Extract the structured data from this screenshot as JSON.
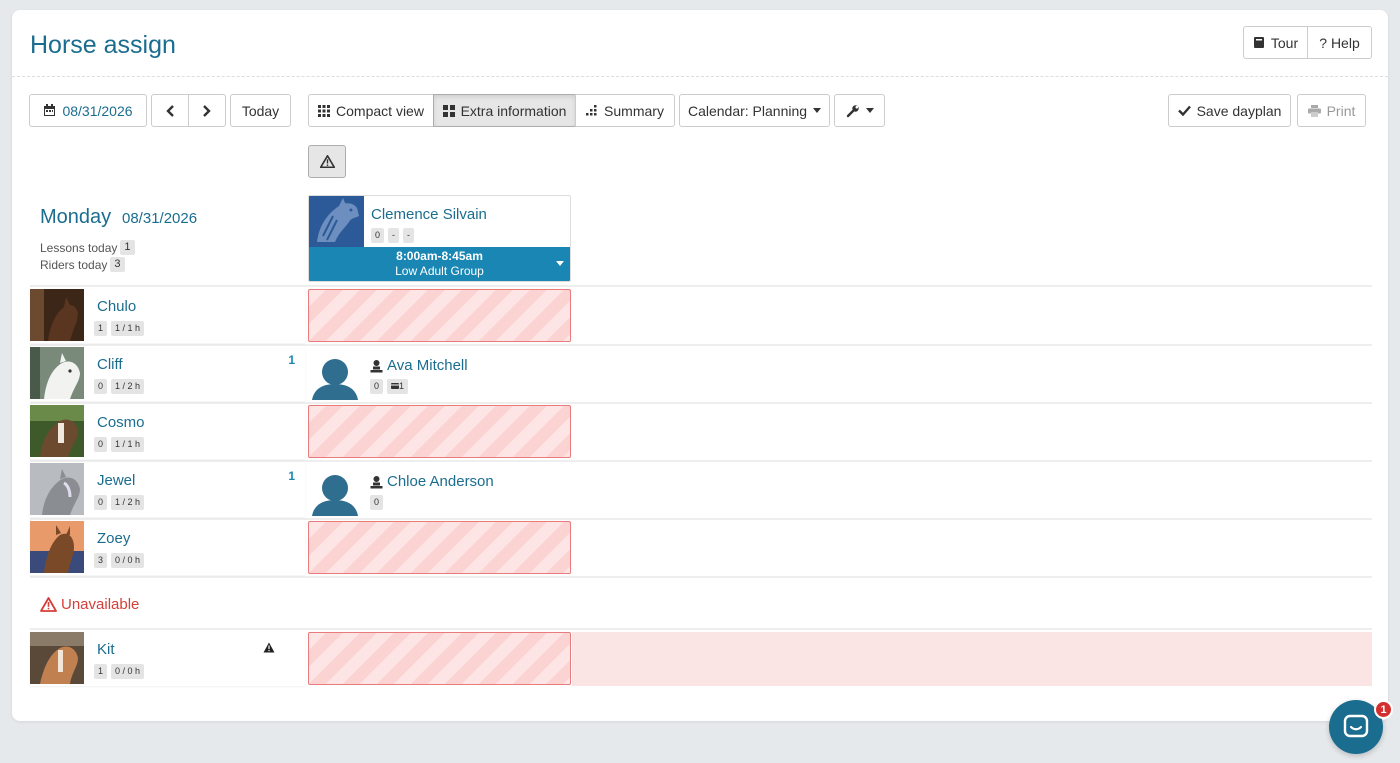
{
  "page": {
    "title": "Horse assign"
  },
  "header_buttons": {
    "tour": "Tour",
    "help": "? Help"
  },
  "toolbar": {
    "date": "08/31/2026",
    "today": "Today",
    "compact_view": "Compact view",
    "extra_information": "Extra information",
    "summary": "Summary",
    "calendar": "Calendar: Planning",
    "save_dayplan": "Save dayplan",
    "print": "Print"
  },
  "day": {
    "name": "Monday",
    "date": "08/31/2026",
    "lessons_label": "Lessons today",
    "lessons_count": "1",
    "riders_label": "Riders today",
    "riders_count": "3"
  },
  "lesson": {
    "instructor": "Clemence Silvain",
    "badges": [
      "0",
      "-",
      "-"
    ],
    "time": "8:00am-8:45am",
    "group": "Low Adult Group"
  },
  "horses": [
    {
      "name": "Chulo",
      "badges": [
        "1",
        "1 / 1 h"
      ],
      "count": ""
    },
    {
      "name": "Cliff",
      "badges": [
        "0",
        "1 / 2 h"
      ],
      "count": "1",
      "rider": {
        "name": "Ava Mitchell",
        "badges": [
          "0",
          "1"
        ]
      }
    },
    {
      "name": "Cosmo",
      "badges": [
        "0",
        "1 / 1 h"
      ],
      "count": ""
    },
    {
      "name": "Jewel",
      "badges": [
        "0",
        "1 / 2 h"
      ],
      "count": "1",
      "rider": {
        "name": "Chloe Anderson",
        "badges": [
          "0"
        ]
      }
    },
    {
      "name": "Zoey",
      "badges": [
        "3",
        "0 / 0 h"
      ],
      "count": ""
    }
  ],
  "unavailable": {
    "label": "Unavailable",
    "horses": [
      {
        "name": "Kit",
        "badges": [
          "1",
          "0 / 0 h"
        ]
      }
    ]
  },
  "chat": {
    "unread": "1"
  },
  "colors": {
    "accent": "#1b6d8f",
    "lesson_bar": "#1a86b3",
    "danger": "#d43f3a"
  }
}
